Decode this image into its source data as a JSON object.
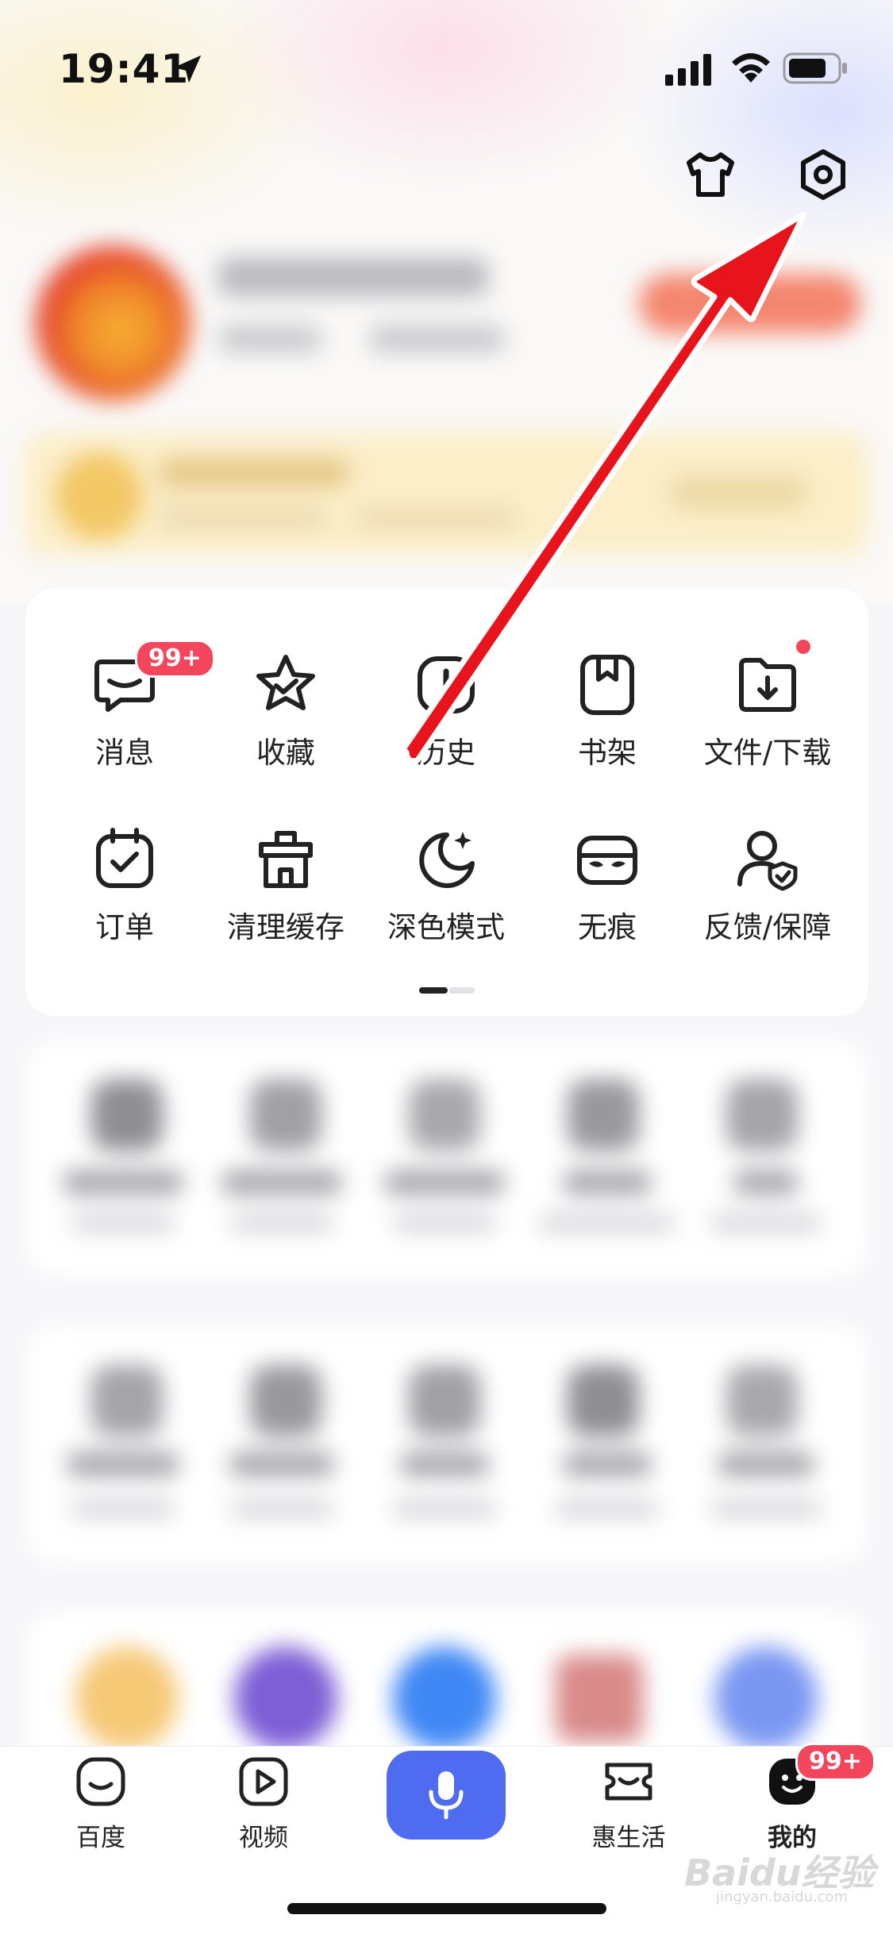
{
  "status_bar": {
    "time": "19:41"
  },
  "header": {
    "skin_icon": "tshirt-icon",
    "settings_icon": "gear-icon"
  },
  "tools": {
    "items": [
      {
        "label": "消息",
        "icon": "message-icon",
        "badge": "99+"
      },
      {
        "label": "收藏",
        "icon": "star-icon"
      },
      {
        "label": "历史",
        "icon": "history-icon"
      },
      {
        "label": "书架",
        "icon": "bookshelf-icon"
      },
      {
        "label": "文件/下载",
        "icon": "download-folder-icon",
        "dot": true
      },
      {
        "label": "订单",
        "icon": "order-calendar-icon"
      },
      {
        "label": "清理缓存",
        "icon": "clean-cache-icon"
      },
      {
        "label": "深色模式",
        "icon": "moon-icon"
      },
      {
        "label": "无痕",
        "icon": "mask-icon"
      },
      {
        "label": "反馈/保障",
        "icon": "user-shield-icon"
      }
    ],
    "pages": 2,
    "current_page": 1
  },
  "tab_bar": {
    "tabs": [
      {
        "label": "百度",
        "icon": "baidu-home-icon"
      },
      {
        "label": "视频",
        "icon": "video-play-icon"
      },
      {
        "label": "",
        "icon": "microphone-icon"
      },
      {
        "label": "惠生活",
        "icon": "ticket-icon"
      },
      {
        "label": "我的",
        "icon": "profile-face-icon",
        "badge": "99+",
        "active": true
      }
    ]
  },
  "colors": {
    "accent_blue": "#4f6bf0",
    "badge_red": "#f3455b",
    "annotation_red": "#e8141b"
  },
  "watermark": {
    "brand": "Baidu经验",
    "url": "jingyan.baidu.com"
  }
}
